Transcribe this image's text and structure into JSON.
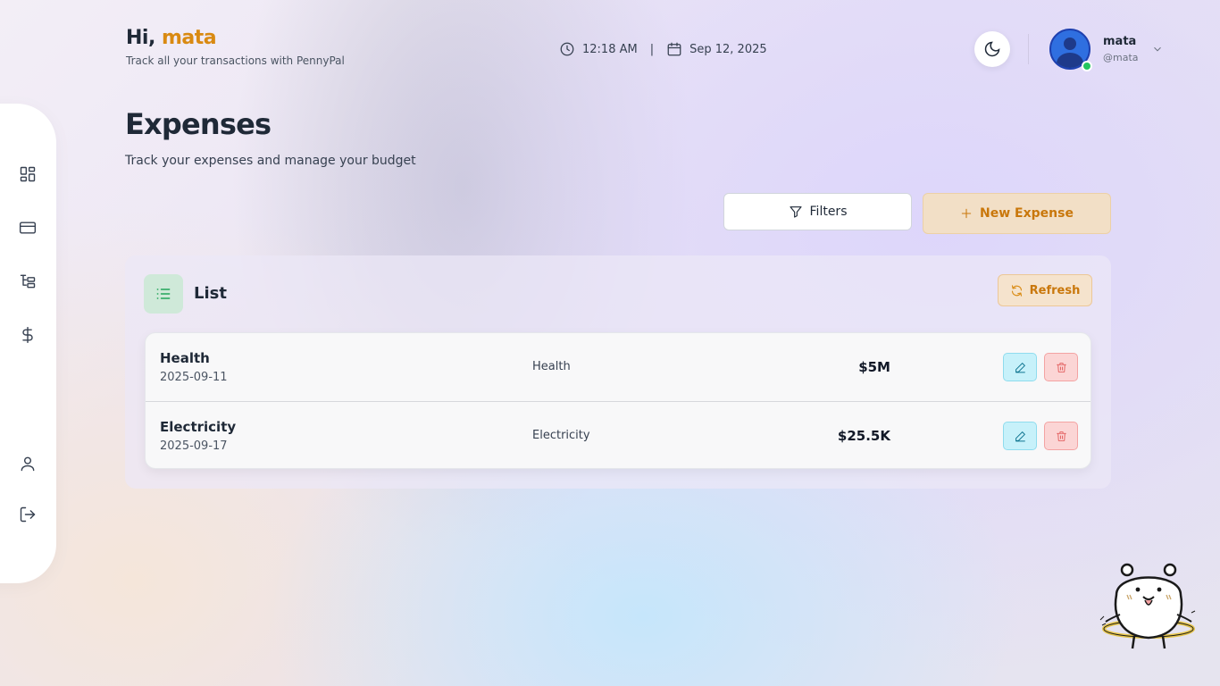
{
  "header": {
    "greeting": "Hi,",
    "user_first": "mata",
    "subtitle": "Track all your transactions with PennyPal",
    "time": "12:18 AM",
    "separator": "|",
    "date": "Sep 12, 2025"
  },
  "user": {
    "name": "mata",
    "handle": "@mata",
    "status": "online",
    "status_color": "#22c55e"
  },
  "sidebar": {
    "items": [
      {
        "name": "dashboard",
        "icon": "dashboard-grid-icon"
      },
      {
        "name": "cards",
        "icon": "credit-card-icon"
      },
      {
        "name": "categories",
        "icon": "tree-structure-icon"
      },
      {
        "name": "expenses",
        "icon": "dollar-icon"
      },
      {
        "name": "profile",
        "icon": "user-icon"
      },
      {
        "name": "logout",
        "icon": "logout-icon"
      }
    ]
  },
  "page": {
    "title": "Expenses",
    "subtitle": "Track your expenses and manage your budget"
  },
  "toolbar": {
    "filters_label": "Filters",
    "new_expense_label": "New Expense"
  },
  "list": {
    "title": "List",
    "refresh_label": "Refresh",
    "rows": [
      {
        "name": "Health",
        "date": "2025-09-11",
        "category": "Health",
        "amount": "$5M"
      },
      {
        "name": "Electricity",
        "date": "2025-09-17",
        "category": "Electricity",
        "amount": "$25.5K"
      }
    ]
  },
  "colors": {
    "accent": "#d98a12",
    "list_icon": "#22a55a",
    "edit": "#0e7490",
    "delete": "#e05252"
  }
}
